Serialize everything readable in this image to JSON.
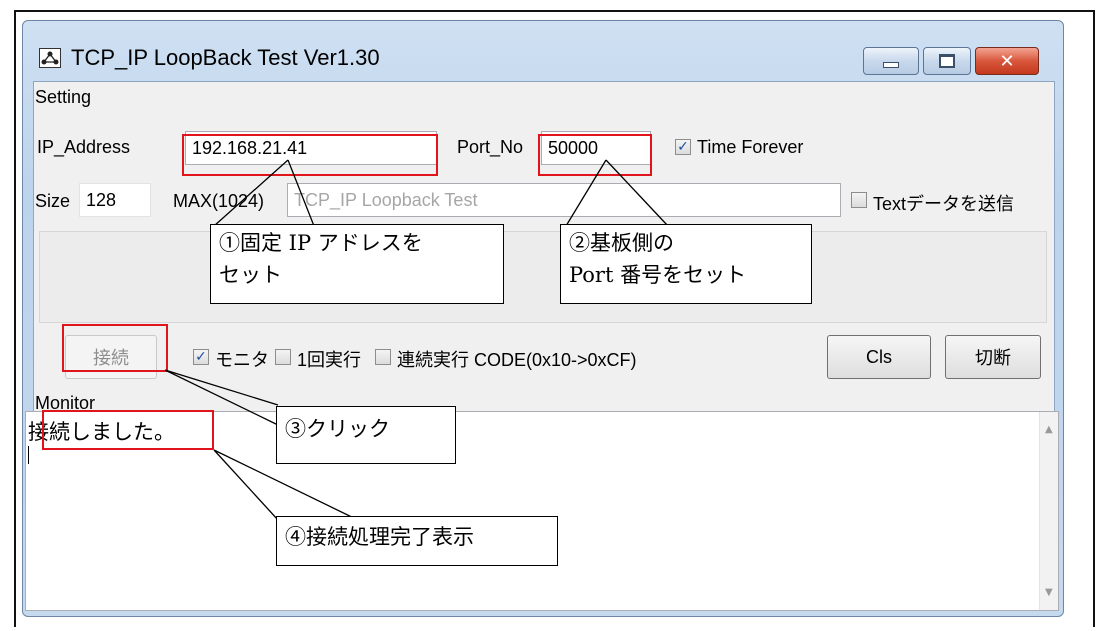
{
  "window": {
    "title": "TCP_IP LoopBack Test Ver1.30"
  },
  "setting": {
    "group_label": "Setting",
    "ip_label": "IP_Address",
    "ip_value": "192.168.21.41",
    "port_label": "Port_No",
    "port_value": "50000",
    "time_forever_label": "Time Forever",
    "time_forever_checked": true,
    "size_label": "Size",
    "size_value": "128",
    "max_label": "MAX(1024)",
    "text_value": "TCP_IP Loopback Test",
    "send_text_label": "Textデータを送信",
    "send_text_checked": false
  },
  "controls": {
    "connect_label": "接続",
    "monitor_label": "モニタ",
    "monitor_checked": true,
    "once_label": "1回実行",
    "once_checked": false,
    "continuous_label": "連続実行 CODE(0x10->0xCF)",
    "continuous_checked": false,
    "cls_label": "Cls",
    "disconnect_label": "切断"
  },
  "monitor": {
    "group_label": "Monitor",
    "text": "接続しました。"
  },
  "callouts": {
    "c1_line1": "①固定 IP アドレスを",
    "c1_line2": "セット",
    "c2_line1": "②基板側の",
    "c2_line2": "Port 番号をセット",
    "c3": "③クリック",
    "c4": "④接続処理完了表示"
  },
  "colors": {
    "highlight": "#e0141a",
    "window_frame": "#bcd3ec"
  }
}
